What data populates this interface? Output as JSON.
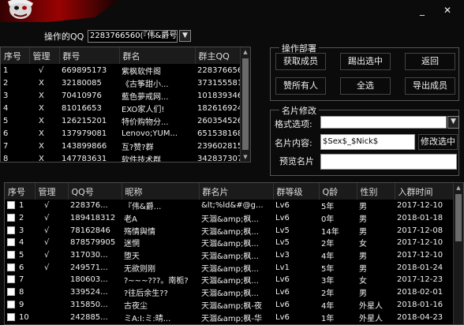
{
  "window": {
    "minimize": "_",
    "close": "✕"
  },
  "top": {
    "operator_label": "操作的QQ",
    "operator_value": "2283766560(『伟&爵号"
  },
  "group_grid": {
    "columns": [
      "序号",
      "管理",
      "群号",
      "群名",
      "群主QQ"
    ],
    "rows": [
      [
        "1",
        "√",
        "669895173",
        "紫枫软件阁",
        "2283766560"
      ],
      [
        "2",
        "X",
        "32180085",
        "《古筝甜小...",
        "373155581"
      ],
      [
        "3",
        "X",
        "70410976",
        "藍色夢戒网...",
        "1018393468"
      ],
      [
        "4",
        "X",
        "81016653",
        "EXO家人们!",
        "1826169240"
      ],
      [
        "5",
        "X",
        "126215201",
        "特价购物分...",
        "2603545264"
      ],
      [
        "6",
        "X",
        "137979081",
        "Lenovo;YUM...",
        "651538168"
      ],
      [
        "7",
        "X",
        "143899866",
        "互?赞?群",
        "2396028154"
      ],
      [
        "8",
        "X",
        "147783631",
        "软件技术群",
        "3428373075"
      ]
    ]
  },
  "ops": {
    "title": "操作部署",
    "get_members": "获取成员",
    "kick_selected": "踢出选中",
    "back": "返回",
    "praise_all": "赞所有人",
    "select_all": "全选",
    "export_members": "导出成员"
  },
  "card": {
    "title": "名片修改",
    "format_label": "格式选项:",
    "format_value": "",
    "content_label": "名片内容:",
    "content_value": "$Sex$_$Nick$",
    "modify_selected": "修改选中",
    "preview_label": "预览名片",
    "preview_value": ""
  },
  "member_grid": {
    "columns": [
      "序号",
      "管理",
      "QQ号",
      "昵称",
      "群名片",
      "群等级",
      "Q龄",
      "性别",
      "入群时间"
    ],
    "rows": [
      [
        "1",
        "√",
        "228376...",
        "『伟&爵...",
        "&lt;%ld&#@g...",
        "Lv6",
        "5年",
        "男",
        "2017-12-10"
      ],
      [
        "2",
        "√",
        "189418312",
        "老A",
        "天涸&amp;枫...",
        "Lv6",
        "0年",
        "男",
        "2018-01-18"
      ],
      [
        "3",
        "√",
        "78162846",
        "殇情與情",
        "天涸&amp;枫...",
        "Lv5",
        "14年",
        "男",
        "2017-12-08"
      ],
      [
        "4",
        "√",
        "878579905",
        "迷惘",
        "天涸&amp;枫...",
        "Lv5",
        "2年",
        "女",
        "2017-12-10"
      ],
      [
        "5",
        "√",
        "317030...",
        "堕天",
        "天涸&amp;枫...",
        "Lv3",
        "4年",
        "男",
        "2017-12-10"
      ],
      [
        "6",
        "√",
        "249571...",
        "无欲则刚",
        "天涸&amp;枫...",
        "Lv1",
        "5年",
        "男",
        "2018-01-24"
      ],
      [
        "7",
        "",
        "180603...",
        "?~~~???。南栀?",
        "天涸&amp;枫...",
        "Lv6",
        "3年",
        "女",
        "2017-12-23"
      ],
      [
        "8",
        "",
        "339524...",
        "?往后余生??",
        "天涸&amp;枫...",
        "Lv6",
        "2年",
        "男",
        "2018-02-01"
      ],
      [
        "9",
        "",
        "315850...",
        "古夜尘",
        "天涸&amp;枫-夜",
        "Lv6",
        "4年",
        "外星人",
        "2018-01-16"
      ],
      [
        "10",
        "",
        "242885...",
        "ミA:I:ミ:晴...",
        "天涸&amp;枫-华",
        "Lv6",
        "1年",
        "外星人",
        "2018-04-23"
      ]
    ]
  }
}
